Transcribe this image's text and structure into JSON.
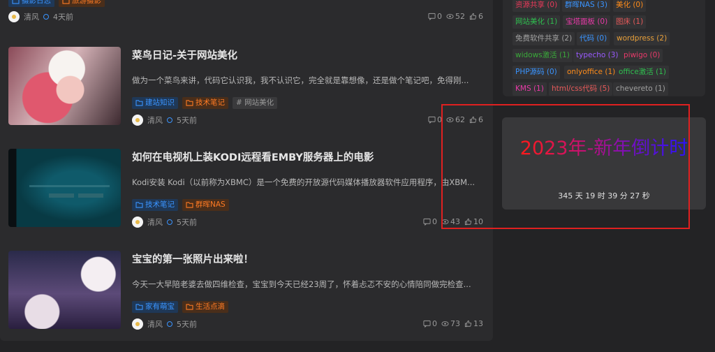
{
  "top_post": {
    "tags": [
      {
        "label": "摄影日志",
        "color": "blue"
      },
      {
        "label": "旅游摄影",
        "color": "orange"
      }
    ],
    "author": "清风",
    "time": "4天前",
    "comments": "0",
    "views": "52",
    "likes": "6"
  },
  "posts": [
    {
      "title": "菜鸟日记-关于网站美化",
      "excerpt": "做为一个菜鸟来讲，代码它认识我，我不认识它，完全就是靠想像，还是做个笔记吧，免得刚...",
      "tags": [
        {
          "label": "建站知识",
          "color": "blue"
        },
        {
          "label": "技术笔记",
          "color": "orange"
        },
        {
          "label": "# 网站美化",
          "color": "gray"
        }
      ],
      "author": "清风",
      "time": "5天前",
      "comments": "0",
      "views": "62",
      "likes": "6"
    },
    {
      "title": "如何在电视机上装KODI远程看EMBY服务器上的电影",
      "excerpt": "Kodi安装 Kodi（以前称为XBMC）是一个免费的开放源代码媒体播放器软件应用程序，由XBM...",
      "tags": [
        {
          "label": "技术笔记",
          "color": "blue"
        },
        {
          "label": "群晖NAS",
          "color": "orange"
        }
      ],
      "author": "清风",
      "time": "5天前",
      "comments": "0",
      "views": "43",
      "likes": "10"
    },
    {
      "title": "宝宝的第一张照片出来啦！",
      "excerpt": "今天一大早陪老婆去做四维检查，宝宝到今天已经23周了，怀着忐忑不安的心情陪同做完检查...",
      "tags": [
        {
          "label": "家有萌宝",
          "color": "blue"
        },
        {
          "label": "生活点滴",
          "color": "orange"
        }
      ],
      "author": "清风",
      "time": "5天前",
      "comments": "0",
      "views": "73",
      "likes": "13"
    }
  ],
  "tag_cloud": [
    {
      "label": "资源共享 (0)",
      "color": "#e83a5a"
    },
    {
      "label": "群晖NAS (3)",
      "color": "#3a94ff"
    },
    {
      "label": "美化 (0)",
      "color": "#ff8c1a"
    },
    {
      "label": "网站美化 (1)",
      "color": "#2fbf4f"
    },
    {
      "label": "宝塔面板 (0)",
      "color": "#e83aa8"
    },
    {
      "label": "图床 (1)",
      "color": "#e85a5a"
    },
    {
      "label": "免费软件共享 (2)",
      "color": "#a0a0a0"
    },
    {
      "label": "代码 (0)",
      "color": "#3a94ff"
    },
    {
      "label": "wordpress (2)",
      "color": "#e8a03a"
    },
    {
      "label": "widows激活 (1)",
      "color": "#3aaa3a"
    },
    {
      "label": "typecho (3)",
      "color": "#9a5aff"
    },
    {
      "label": "piwigo (0)",
      "color": "#e83a6a"
    },
    {
      "label": "PHP源码 (0)",
      "color": "#3a94ff"
    },
    {
      "label": "onlyoffice (1)",
      "color": "#ff8c1a"
    },
    {
      "label": "office激活 (1)",
      "color": "#2fbf4f"
    },
    {
      "label": "KMS (1)",
      "color": "#e83aa8"
    },
    {
      "label": "html/css代码 (5)",
      "color": "#e85a5a"
    },
    {
      "label": "chevereto (1)",
      "color": "#a0a0a0"
    }
  ],
  "countdown": {
    "title": "2023年-新年倒计时",
    "remaining": "345 天 19 时 39 分 27 秒"
  },
  "colors": {
    "accent_blue": "#3a94ff",
    "accent_orange": "#ff7b24",
    "highlight_red": "#e02020"
  }
}
